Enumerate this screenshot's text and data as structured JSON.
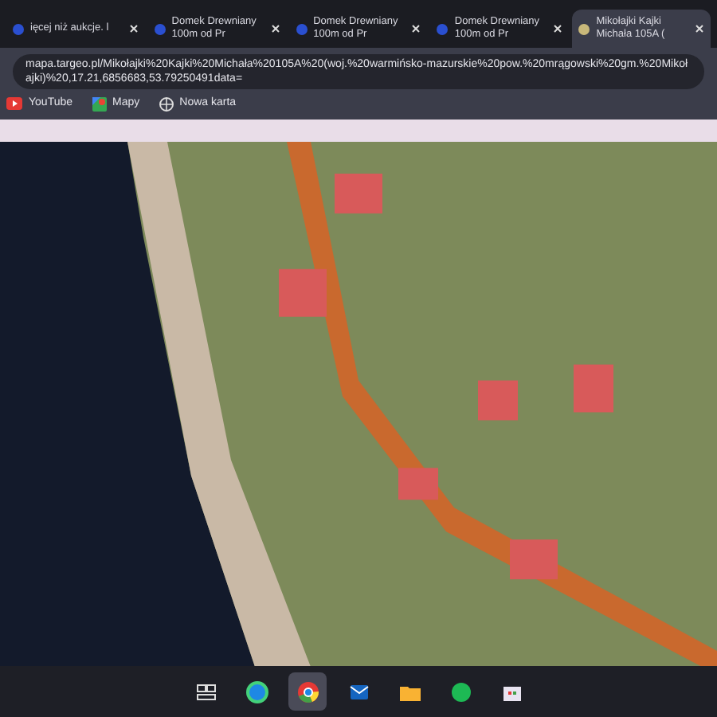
{
  "tabs": [
    {
      "title": "ięcej niż aukcje. l",
      "selected": false
    },
    {
      "title": "Domek Drewniany 100m od Pr",
      "selected": false
    },
    {
      "title": "Domek Drewniany 100m od Pr",
      "selected": false
    },
    {
      "title": "Domek Drewniany 100m od Pr",
      "selected": false
    },
    {
      "title": "Mikołajki Kajki Michała 105A (",
      "selected": true
    }
  ],
  "address_bar": {
    "value": "mapa.targeo.pl/Mikołajki%20Kajki%20Michała%20105A%20(woj.%20warmińsko-mazurskie%20pow.%20mrągowski%20gm.%20Mikołajki)%20,17.21,6856683,53.79250491data="
  },
  "bookmarks": [
    {
      "label": "YouTube",
      "kind": "youtube"
    },
    {
      "label": "Mapy",
      "kind": "maps"
    },
    {
      "label": "Nowa karta",
      "kind": "globe"
    }
  ],
  "taskbar": {
    "items": [
      {
        "kind": "taskview",
        "selected": false
      },
      {
        "kind": "edge",
        "selected": false
      },
      {
        "kind": "chrome",
        "selected": true
      },
      {
        "kind": "mail",
        "selected": false
      },
      {
        "kind": "folder",
        "selected": false
      },
      {
        "kind": "spotify",
        "selected": false
      },
      {
        "kind": "store",
        "selected": false
      }
    ]
  }
}
